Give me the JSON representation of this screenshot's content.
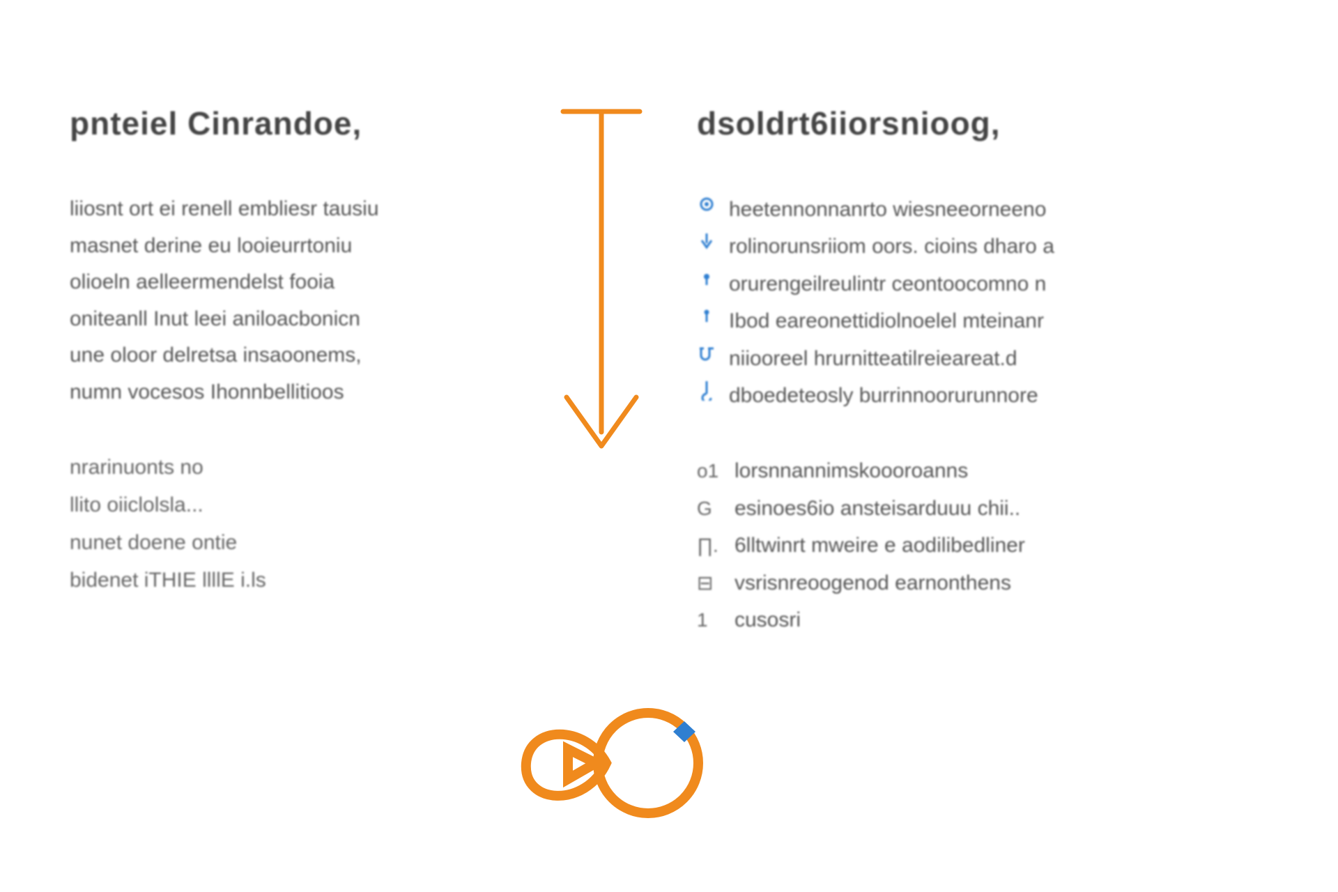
{
  "left": {
    "heading": "pnteiel Cinrandoe,",
    "paragraph": [
      "liiosnt ort ei renell embliesr tausiu",
      "masnet derine eu looieurrtoniu",
      "olioeln aelleermendelst fooia",
      "oniteanll Inut leei aniloacbonicn",
      "une oloor delretsa insaoonems,",
      "numn vocesos Ihonnbellitioos"
    ],
    "sublines": [
      "nrarinuonts no",
      "llito oiiclolsla...",
      "nunet doene ontie",
      "bidenet iTHIE llllE i.ls"
    ]
  },
  "right": {
    "heading": "dsoldrt6iiorsnioog,",
    "bullets": [
      {
        "icon": "circle-g",
        "text": "heetennonnanrto wiesneeorneeno"
      },
      {
        "icon": "caret-down",
        "text": "rolinorunsriiom oors. cioins dharo a"
      },
      {
        "icon": "dot-s",
        "text": "orurengeilreulintr ceontoocomno n"
      },
      {
        "icon": "dot-u",
        "text": "Ibod eareonettidiolnoelel mteinanr"
      },
      {
        "icon": "u-e",
        "text": "niiooreel hrurnitteatilreieareat.d"
      },
      {
        "icon": "hook-down",
        "text": "dboedeteosly burrinnoorurunnore"
      }
    ],
    "secondary": [
      {
        "marker": "o1",
        "text": "lorsnnannimskoooroanns"
      },
      {
        "marker": "G",
        "text": "esinoes6io ansteisarduuu chii.."
      },
      {
        "marker": "∏.",
        "text": "6lltwinrt mweire e aodilibedliner"
      },
      {
        "marker": "⊟",
        "text": "vsrisnreoogenod earnonthens"
      },
      {
        "marker": "1",
        "text": "cusosri"
      }
    ]
  },
  "colors": {
    "accent": "#f08a1d",
    "blue": "#2f7fd1"
  }
}
